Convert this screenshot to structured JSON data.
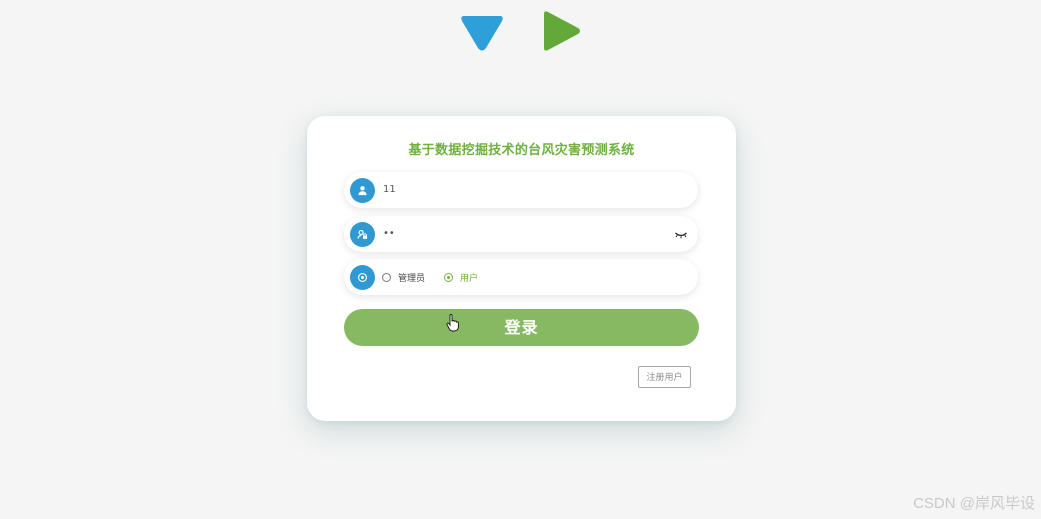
{
  "header": {
    "logo_down_icon": "blue-down-triangle-icon",
    "logo_play_icon": "green-play-triangle-icon",
    "logo_down_color": "#2f9fda",
    "logo_play_color": "#62a93a"
  },
  "login": {
    "title": "基于数据挖掘技术的台风灾害预测系统",
    "username": {
      "icon": "user-icon",
      "value": "11"
    },
    "password": {
      "icon": "lock-user-icon",
      "value": "••",
      "toggle_icon": "eye-closed-icon"
    },
    "role": {
      "icon": "role-icon",
      "options": [
        {
          "label": "管理员",
          "checked": false
        },
        {
          "label": "用户",
          "checked": true
        }
      ]
    },
    "login_button": "登录",
    "register_button": "注册用户"
  },
  "colors": {
    "accent_green": "#6fb040",
    "button_green": "#87b862",
    "icon_blue": "#3098d2"
  },
  "watermark": "CSDN @岸风毕设"
}
